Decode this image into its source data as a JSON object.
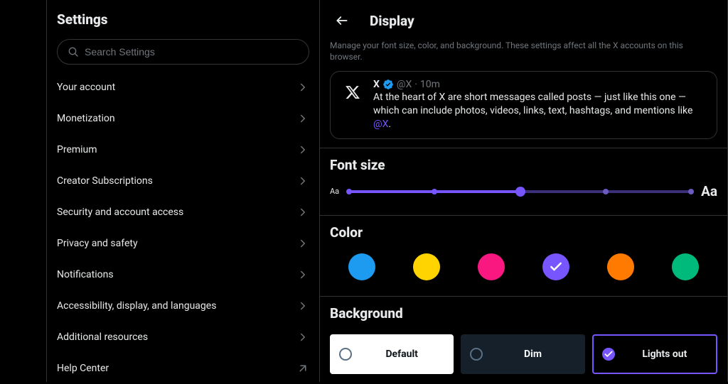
{
  "accent": "#7856ff",
  "sidebar": {
    "title": "Settings",
    "search_placeholder": "Search Settings",
    "items": [
      {
        "label": "Your account",
        "external": false
      },
      {
        "label": "Monetization",
        "external": false
      },
      {
        "label": "Premium",
        "external": false
      },
      {
        "label": "Creator Subscriptions",
        "external": false
      },
      {
        "label": "Security and account access",
        "external": false
      },
      {
        "label": "Privacy and safety",
        "external": false
      },
      {
        "label": "Notifications",
        "external": false
      },
      {
        "label": "Accessibility, display, and languages",
        "external": false
      },
      {
        "label": "Additional resources",
        "external": false
      },
      {
        "label": "Help Center",
        "external": true
      }
    ]
  },
  "page": {
    "title": "Display",
    "description": "Manage your font size, color, and background. These settings affect all the X accounts on this browser."
  },
  "sample_post": {
    "name": "X",
    "handle": "@X",
    "time": "10m",
    "separator": "·",
    "body_pre": "At the heart of X are short messages called posts — just like this one — which can include photos, videos, links, text, hashtags, and mentions like ",
    "mention": "@X",
    "body_post": "."
  },
  "font_size": {
    "heading": "Font size",
    "min_label": "Aa",
    "max_label": "Aa",
    "steps": 5,
    "selected_index": 2
  },
  "color": {
    "heading": "Color",
    "options": [
      {
        "name": "blue",
        "hex": "#1d9bf0",
        "selected": false
      },
      {
        "name": "yellow",
        "hex": "#ffd400",
        "selected": false
      },
      {
        "name": "pink",
        "hex": "#f91880",
        "selected": false
      },
      {
        "name": "purple",
        "hex": "#7856ff",
        "selected": true
      },
      {
        "name": "orange",
        "hex": "#ff7a00",
        "selected": false
      },
      {
        "name": "green",
        "hex": "#00ba7c",
        "selected": false
      }
    ]
  },
  "background": {
    "heading": "Background",
    "options": [
      {
        "label": "Default",
        "bg": "#ffffff",
        "fg": "#0f1419",
        "selected": false
      },
      {
        "label": "Dim",
        "bg": "#15202b",
        "fg": "#f7f9f9",
        "selected": false
      },
      {
        "label": "Lights out",
        "bg": "#000000",
        "fg": "#e7e9ea",
        "selected": true
      }
    ]
  }
}
